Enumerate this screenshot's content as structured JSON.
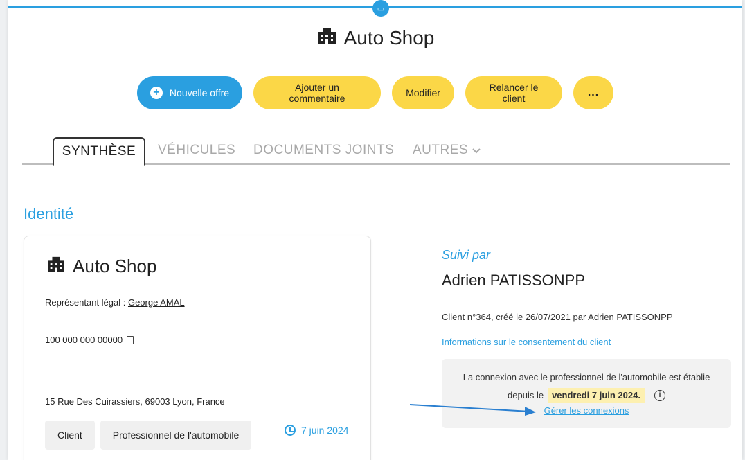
{
  "header": {
    "title": "Auto Shop",
    "building_icon": "building-icon"
  },
  "actions": {
    "new_offer": "Nouvelle offre",
    "add_comment": "Ajouter un commentaire",
    "modify": "Modifier",
    "remind": "Relancer le client",
    "more": "..."
  },
  "tabs": [
    {
      "label": "SYNTHÈSE",
      "active": true
    },
    {
      "label": "VÉHICULES",
      "active": false
    },
    {
      "label": "DOCUMENTS JOINTS",
      "active": false
    },
    {
      "label": "AUTRES",
      "active": false
    }
  ],
  "identity": {
    "section_title": "Identité",
    "name": "Auto Shop",
    "rep_label": "Représentant légal : ",
    "rep_name": "George AMAL",
    "siret": "100 000 000 00000",
    "address": "15 Rue Des Cuirassiers, 69003 Lyon, France",
    "chips": [
      "Client",
      "Professionnel de l'automobile"
    ],
    "date": "7 juin 2024"
  },
  "follow": {
    "label": "Suivi par",
    "name": "Adrien PATISSONPP",
    "client_info": "Client n°364, créé le 26/07/2021 par Adrien PATISSONPP",
    "consent_link": "Informations sur le consentement du client",
    "connection_text": "La connexion avec le professionnel de l'automobile est établie",
    "since_label": "depuis le",
    "since_date": "vendredi 7 juin 2024.",
    "manage_link": "Gérer les connexions"
  },
  "colors": {
    "accent": "#2a9fe0",
    "button_yellow": "#fbd747",
    "highlight": "#fdf0b0"
  }
}
